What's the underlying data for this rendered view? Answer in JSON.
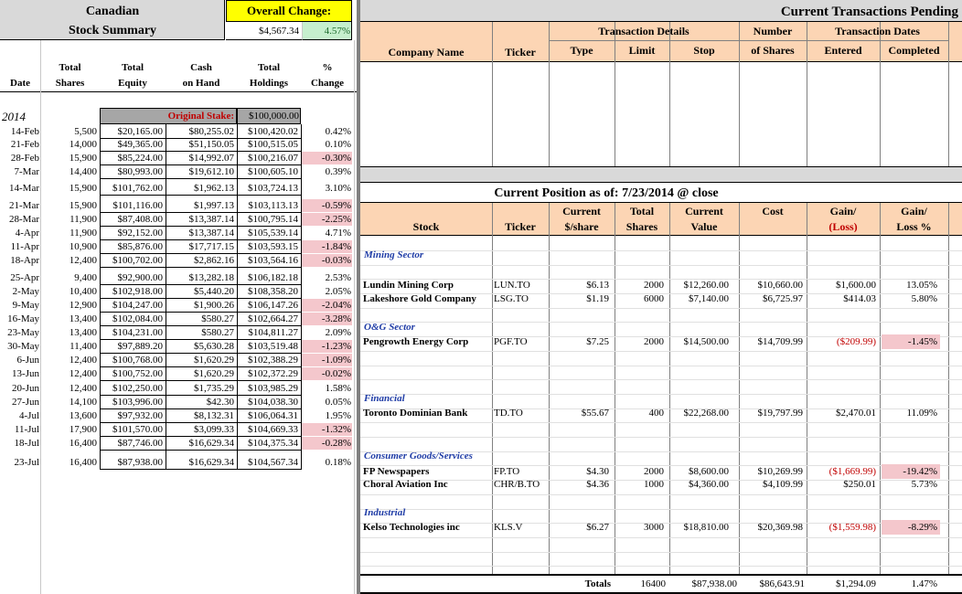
{
  "summary": {
    "title_line1": "Canadian",
    "title_line2": "Stock Summary",
    "overall_change_label": "Overall Change:",
    "overall_change_value": "$4,567.34",
    "overall_change_pct": "4.57%",
    "col_headers": [
      {
        "l1": "",
        "l2": "Date"
      },
      {
        "l1": "Total",
        "l2": "Shares"
      },
      {
        "l1": "Total",
        "l2": "Equity"
      },
      {
        "l1": "Cash",
        "l2": "on Hand"
      },
      {
        "l1": "Total",
        "l2": "Holdings"
      },
      {
        "l1": "%",
        "l2": "Change"
      }
    ],
    "year": "2014",
    "original_stake_label": "Original Stake:",
    "original_stake_value": "$100,000.00",
    "rows": [
      {
        "date": "14-Feb",
        "shares": "5,500",
        "equity": "$20,165.00",
        "cash": "$80,255.02",
        "holdings": "$100,420.02",
        "pct": "0.42%",
        "neg": false
      },
      {
        "date": "21-Feb",
        "shares": "14,000",
        "equity": "$49,365.00",
        "cash": "$51,150.05",
        "holdings": "$100,515.05",
        "pct": "0.10%",
        "neg": false
      },
      {
        "date": "28-Feb",
        "shares": "15,900",
        "equity": "$85,224.00",
        "cash": "$14,992.07",
        "holdings": "$100,216.07",
        "pct": "-0.30%",
        "neg": true
      },
      {
        "date": "7-Mar",
        "shares": "14,400",
        "equity": "$80,993.00",
        "cash": "$19,612.10",
        "holdings": "$100,605.10",
        "pct": "0.39%",
        "neg": false
      },
      {
        "date": "14-Mar",
        "shares": "15,900",
        "equity": "$101,762.00",
        "cash": "$1,962.13",
        "holdings": "$103,724.13",
        "pct": "3.10%",
        "neg": false
      },
      {
        "date": "21-Mar",
        "shares": "15,900",
        "equity": "$101,116.00",
        "cash": "$1,997.13",
        "holdings": "$103,113.13",
        "pct": "-0.59%",
        "neg": true
      },
      {
        "date": "28-Mar",
        "shares": "11,900",
        "equity": "$87,408.00",
        "cash": "$13,387.14",
        "holdings": "$100,795.14",
        "pct": "-2.25%",
        "neg": true
      },
      {
        "date": "4-Apr",
        "shares": "11,900",
        "equity": "$92,152.00",
        "cash": "$13,387.14",
        "holdings": "$105,539.14",
        "pct": "4.71%",
        "neg": false
      },
      {
        "date": "11-Apr",
        "shares": "10,900",
        "equity": "$85,876.00",
        "cash": "$17,717.15",
        "holdings": "$103,593.15",
        "pct": "-1.84%",
        "neg": true
      },
      {
        "date": "18-Apr",
        "shares": "12,400",
        "equity": "$100,702.00",
        "cash": "$2,862.16",
        "holdings": "$103,564.16",
        "pct": "-0.03%",
        "neg": true
      },
      {
        "date": "25-Apr",
        "shares": "9,400",
        "equity": "$92,900.00",
        "cash": "$13,282.18",
        "holdings": "$106,182.18",
        "pct": "2.53%",
        "neg": false
      },
      {
        "date": "2-May",
        "shares": "10,400",
        "equity": "$102,918.00",
        "cash": "$5,440.20",
        "holdings": "$108,358.20",
        "pct": "2.05%",
        "neg": false
      },
      {
        "date": "9-May",
        "shares": "12,900",
        "equity": "$104,247.00",
        "cash": "$1,900.26",
        "holdings": "$106,147.26",
        "pct": "-2.04%",
        "neg": true
      },
      {
        "date": "16-May",
        "shares": "13,400",
        "equity": "$102,084.00",
        "cash": "$580.27",
        "holdings": "$102,664.27",
        "pct": "-3.28%",
        "neg": true
      },
      {
        "date": "23-May",
        "shares": "13,400",
        "equity": "$104,231.00",
        "cash": "$580.27",
        "holdings": "$104,811.27",
        "pct": "2.09%",
        "neg": false
      },
      {
        "date": "30-May",
        "shares": "11,400",
        "equity": "$97,889.20",
        "cash": "$5,630.28",
        "holdings": "$103,519.48",
        "pct": "-1.23%",
        "neg": true
      },
      {
        "date": "6-Jun",
        "shares": "12,400",
        "equity": "$100,768.00",
        "cash": "$1,620.29",
        "holdings": "$102,388.29",
        "pct": "-1.09%",
        "neg": true
      },
      {
        "date": "13-Jun",
        "shares": "12,400",
        "equity": "$100,752.00",
        "cash": "$1,620.29",
        "holdings": "$102,372.29",
        "pct": "-0.02%",
        "neg": true
      },
      {
        "date": "20-Jun",
        "shares": "12,400",
        "equity": "$102,250.00",
        "cash": "$1,735.29",
        "holdings": "$103,985.29",
        "pct": "1.58%",
        "neg": false
      },
      {
        "date": "27-Jun",
        "shares": "14,100",
        "equity": "$103,996.00",
        "cash": "$42.30",
        "holdings": "$104,038.30",
        "pct": "0.05%",
        "neg": false
      },
      {
        "date": "4-Jul",
        "shares": "13,600",
        "equity": "$97,932.00",
        "cash": "$8,132.31",
        "holdings": "$106,064.31",
        "pct": "1.95%",
        "neg": false
      },
      {
        "date": "11-Jul",
        "shares": "17,900",
        "equity": "$101,570.00",
        "cash": "$3,099.33",
        "holdings": "$104,669.33",
        "pct": "-1.32%",
        "neg": true
      },
      {
        "date": "18-Jul",
        "shares": "16,400",
        "equity": "$87,746.00",
        "cash": "$16,629.34",
        "holdings": "$104,375.34",
        "pct": "-0.28%",
        "neg": true
      },
      {
        "date": "23-Jul",
        "shares": "16,400",
        "equity": "$87,938.00",
        "cash": "$16,629.34",
        "holdings": "$104,567.34",
        "pct": "0.18%",
        "neg": false
      }
    ]
  },
  "pending": {
    "title": "Current Transactions Pending",
    "group_details": "Transaction Details",
    "group_number": "Number",
    "group_dates": "Transaction Dates",
    "col_company": "Company Name",
    "col_ticker": "Ticker",
    "col_type": "Type",
    "col_limit": "Limit",
    "col_stop": "Stop",
    "col_shares": "of Shares",
    "col_entered": "Entered",
    "col_completed": "Completed"
  },
  "position": {
    "title": "Current Position as of:  7/23/2014  @ close",
    "headers": [
      {
        "l1": "",
        "l2": "Stock"
      },
      {
        "l1": "",
        "l2": "Ticker"
      },
      {
        "l1": "Current",
        "l2": "$/share"
      },
      {
        "l1": "Total",
        "l2": "Shares"
      },
      {
        "l1": "Current",
        "l2": "Value"
      },
      {
        "l1": "Cost",
        "l2": ""
      },
      {
        "l1": "Gain/",
        "l2": "(Loss)"
      },
      {
        "l1": "Gain/",
        "l2": "Loss %"
      }
    ],
    "sectors": [
      {
        "name": "Mining Sector",
        "stocks": [
          {
            "name": "Lundin Mining Corp",
            "ticker": "LUN.TO",
            "price": "$6.13",
            "shares": "2000",
            "value": "$12,260.00",
            "cost": "$10,660.00",
            "gain": "$1,600.00",
            "pct": "13.05%",
            "neg": false
          },
          {
            "name": "Lakeshore Gold Company",
            "ticker": "LSG.TO",
            "price": "$1.19",
            "shares": "6000",
            "value": "$7,140.00",
            "cost": "$6,725.97",
            "gain": "$414.03",
            "pct": "5.80%",
            "neg": false
          }
        ]
      },
      {
        "name": "O&G Sector",
        "stocks": [
          {
            "name": "Pengrowth Energy Corp",
            "ticker": "PGF.TO",
            "price": "$7.25",
            "shares": "2000",
            "value": "$14,500.00",
            "cost": "$14,709.99",
            "gain": "($209.99)",
            "pct": "-1.45%",
            "neg": true
          }
        ]
      },
      {
        "name": "Financial",
        "stocks": [
          {
            "name": "Toronto Dominian Bank",
            "ticker": "TD.TO",
            "price": "$55.67",
            "shares": "400",
            "value": "$22,268.00",
            "cost": "$19,797.99",
            "gain": "$2,470.01",
            "pct": "11.09%",
            "neg": false
          }
        ]
      },
      {
        "name": "Consumer Goods/Services",
        "stocks": [
          {
            "name": "FP Newspapers",
            "ticker": "FP.TO",
            "price": "$4.30",
            "shares": "2000",
            "value": "$8,600.00",
            "cost": "$10,269.99",
            "gain": "($1,669.99)",
            "pct": "-19.42%",
            "neg": true
          },
          {
            "name": "Choral Aviation Inc",
            "ticker": "CHR/B.TO",
            "price": "$4.36",
            "shares": "1000",
            "value": "$4,360.00",
            "cost": "$4,109.99",
            "gain": "$250.01",
            "pct": "5.73%",
            "neg": false
          }
        ]
      },
      {
        "name": "Industrial",
        "stocks": [
          {
            "name": "Kelso Technologies inc",
            "ticker": "KLS.V",
            "price": "$6.27",
            "shares": "3000",
            "value": "$18,810.00",
            "cost": "$20,369.98",
            "gain": "($1,559.98)",
            "pct": "-8.29%",
            "neg": true
          }
        ]
      }
    ],
    "totals": {
      "label": "Totals",
      "shares": "16400",
      "value": "$87,938.00",
      "cost": "$86,643.91",
      "gain": "$1,294.09",
      "pct": "1.47%"
    }
  },
  "colors": {
    "orange_header": "#fcd5b4",
    "gray_header": "#d9d9d9",
    "yellow": "#ffff00",
    "green": "#c6efce",
    "pink": "#f4c7cc",
    "red_text": "#c00000",
    "blue_text": "#1f3ca6"
  }
}
